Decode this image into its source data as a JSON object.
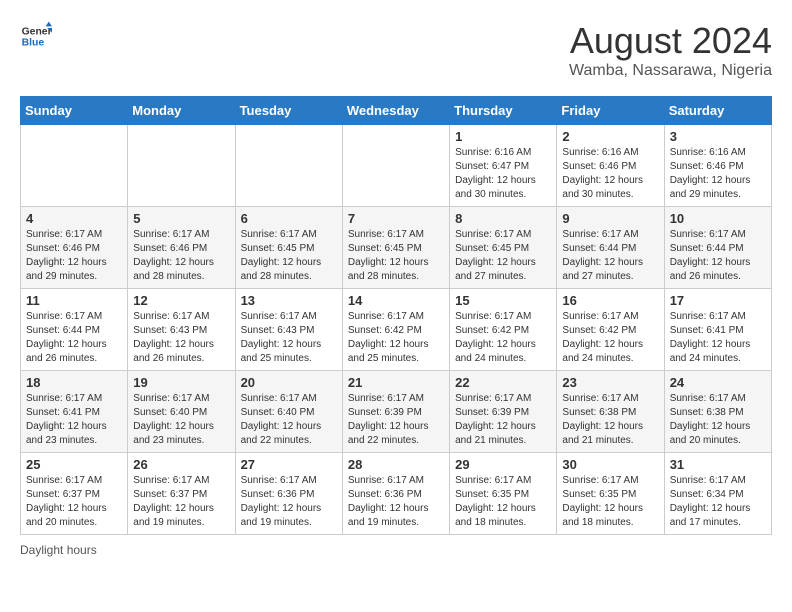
{
  "logo": {
    "general": "General",
    "blue": "Blue"
  },
  "title": "August 2024",
  "subtitle": "Wamba, Nassarawa, Nigeria",
  "days_of_week": [
    "Sunday",
    "Monday",
    "Tuesday",
    "Wednesday",
    "Thursday",
    "Friday",
    "Saturday"
  ],
  "footer": "Daylight hours",
  "weeks": [
    [
      {
        "day": "",
        "info": ""
      },
      {
        "day": "",
        "info": ""
      },
      {
        "day": "",
        "info": ""
      },
      {
        "day": "",
        "info": ""
      },
      {
        "day": "1",
        "info": "Sunrise: 6:16 AM\nSunset: 6:47 PM\nDaylight: 12 hours\nand 30 minutes."
      },
      {
        "day": "2",
        "info": "Sunrise: 6:16 AM\nSunset: 6:46 PM\nDaylight: 12 hours\nand 30 minutes."
      },
      {
        "day": "3",
        "info": "Sunrise: 6:16 AM\nSunset: 6:46 PM\nDaylight: 12 hours\nand 29 minutes."
      }
    ],
    [
      {
        "day": "4",
        "info": "Sunrise: 6:17 AM\nSunset: 6:46 PM\nDaylight: 12 hours\nand 29 minutes."
      },
      {
        "day": "5",
        "info": "Sunrise: 6:17 AM\nSunset: 6:46 PM\nDaylight: 12 hours\nand 28 minutes."
      },
      {
        "day": "6",
        "info": "Sunrise: 6:17 AM\nSunset: 6:45 PM\nDaylight: 12 hours\nand 28 minutes."
      },
      {
        "day": "7",
        "info": "Sunrise: 6:17 AM\nSunset: 6:45 PM\nDaylight: 12 hours\nand 28 minutes."
      },
      {
        "day": "8",
        "info": "Sunrise: 6:17 AM\nSunset: 6:45 PM\nDaylight: 12 hours\nand 27 minutes."
      },
      {
        "day": "9",
        "info": "Sunrise: 6:17 AM\nSunset: 6:44 PM\nDaylight: 12 hours\nand 27 minutes."
      },
      {
        "day": "10",
        "info": "Sunrise: 6:17 AM\nSunset: 6:44 PM\nDaylight: 12 hours\nand 26 minutes."
      }
    ],
    [
      {
        "day": "11",
        "info": "Sunrise: 6:17 AM\nSunset: 6:44 PM\nDaylight: 12 hours\nand 26 minutes."
      },
      {
        "day": "12",
        "info": "Sunrise: 6:17 AM\nSunset: 6:43 PM\nDaylight: 12 hours\nand 26 minutes."
      },
      {
        "day": "13",
        "info": "Sunrise: 6:17 AM\nSunset: 6:43 PM\nDaylight: 12 hours\nand 25 minutes."
      },
      {
        "day": "14",
        "info": "Sunrise: 6:17 AM\nSunset: 6:42 PM\nDaylight: 12 hours\nand 25 minutes."
      },
      {
        "day": "15",
        "info": "Sunrise: 6:17 AM\nSunset: 6:42 PM\nDaylight: 12 hours\nand 24 minutes."
      },
      {
        "day": "16",
        "info": "Sunrise: 6:17 AM\nSunset: 6:42 PM\nDaylight: 12 hours\nand 24 minutes."
      },
      {
        "day": "17",
        "info": "Sunrise: 6:17 AM\nSunset: 6:41 PM\nDaylight: 12 hours\nand 24 minutes."
      }
    ],
    [
      {
        "day": "18",
        "info": "Sunrise: 6:17 AM\nSunset: 6:41 PM\nDaylight: 12 hours\nand 23 minutes."
      },
      {
        "day": "19",
        "info": "Sunrise: 6:17 AM\nSunset: 6:40 PM\nDaylight: 12 hours\nand 23 minutes."
      },
      {
        "day": "20",
        "info": "Sunrise: 6:17 AM\nSunset: 6:40 PM\nDaylight: 12 hours\nand 22 minutes."
      },
      {
        "day": "21",
        "info": "Sunrise: 6:17 AM\nSunset: 6:39 PM\nDaylight: 12 hours\nand 22 minutes."
      },
      {
        "day": "22",
        "info": "Sunrise: 6:17 AM\nSunset: 6:39 PM\nDaylight: 12 hours\nand 21 minutes."
      },
      {
        "day": "23",
        "info": "Sunrise: 6:17 AM\nSunset: 6:38 PM\nDaylight: 12 hours\nand 21 minutes."
      },
      {
        "day": "24",
        "info": "Sunrise: 6:17 AM\nSunset: 6:38 PM\nDaylight: 12 hours\nand 20 minutes."
      }
    ],
    [
      {
        "day": "25",
        "info": "Sunrise: 6:17 AM\nSunset: 6:37 PM\nDaylight: 12 hours\nand 20 minutes."
      },
      {
        "day": "26",
        "info": "Sunrise: 6:17 AM\nSunset: 6:37 PM\nDaylight: 12 hours\nand 19 minutes."
      },
      {
        "day": "27",
        "info": "Sunrise: 6:17 AM\nSunset: 6:36 PM\nDaylight: 12 hours\nand 19 minutes."
      },
      {
        "day": "28",
        "info": "Sunrise: 6:17 AM\nSunset: 6:36 PM\nDaylight: 12 hours\nand 19 minutes."
      },
      {
        "day": "29",
        "info": "Sunrise: 6:17 AM\nSunset: 6:35 PM\nDaylight: 12 hours\nand 18 minutes."
      },
      {
        "day": "30",
        "info": "Sunrise: 6:17 AM\nSunset: 6:35 PM\nDaylight: 12 hours\nand 18 minutes."
      },
      {
        "day": "31",
        "info": "Sunrise: 6:17 AM\nSunset: 6:34 PM\nDaylight: 12 hours\nand 17 minutes."
      }
    ]
  ]
}
